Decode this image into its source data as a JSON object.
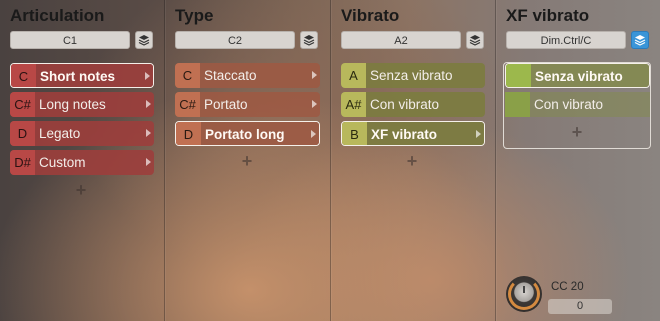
{
  "columns": [
    {
      "title": "Articulation",
      "key_value": "C1",
      "layers_active": false,
      "items": [
        {
          "key": "C",
          "label": "Short notes",
          "selected": true
        },
        {
          "key": "C#",
          "label": "Long notes",
          "selected": false
        },
        {
          "key": "D",
          "label": "Legato",
          "selected": false
        },
        {
          "key": "D#",
          "label": "Custom",
          "selected": false
        }
      ]
    },
    {
      "title": "Type",
      "key_value": "C2",
      "layers_active": false,
      "items": [
        {
          "key": "C",
          "label": "Staccato",
          "selected": false
        },
        {
          "key": "C#",
          "label": "Portato",
          "selected": false
        },
        {
          "key": "D",
          "label": "Portato long",
          "selected": true
        }
      ]
    },
    {
      "title": "Vibrato",
      "key_value": "A2",
      "layers_active": false,
      "items": [
        {
          "key": "A",
          "label": "Senza vibrato",
          "selected": false
        },
        {
          "key": "A#",
          "label": "Con vibrato",
          "selected": false
        },
        {
          "key": "B",
          "label": "XF vibrato",
          "selected": true
        }
      ]
    },
    {
      "title": "XF vibrato",
      "key_value": "Dim.Ctrl/C",
      "layers_active": true,
      "items": [
        {
          "key": "",
          "label": "Senza vibrato",
          "selected": true
        },
        {
          "key": "",
          "label": "Con vibrato",
          "selected": false
        }
      ]
    }
  ],
  "add_symbol": "+",
  "controller": {
    "label": "CC 20",
    "value": "0"
  },
  "colors": {
    "articulation": "#9c3e3c",
    "type": "#9c5a44",
    "vibrato": "#7c7c40",
    "xf_vibrato": "#9cb84c",
    "layers_active": "#3a95d8"
  }
}
